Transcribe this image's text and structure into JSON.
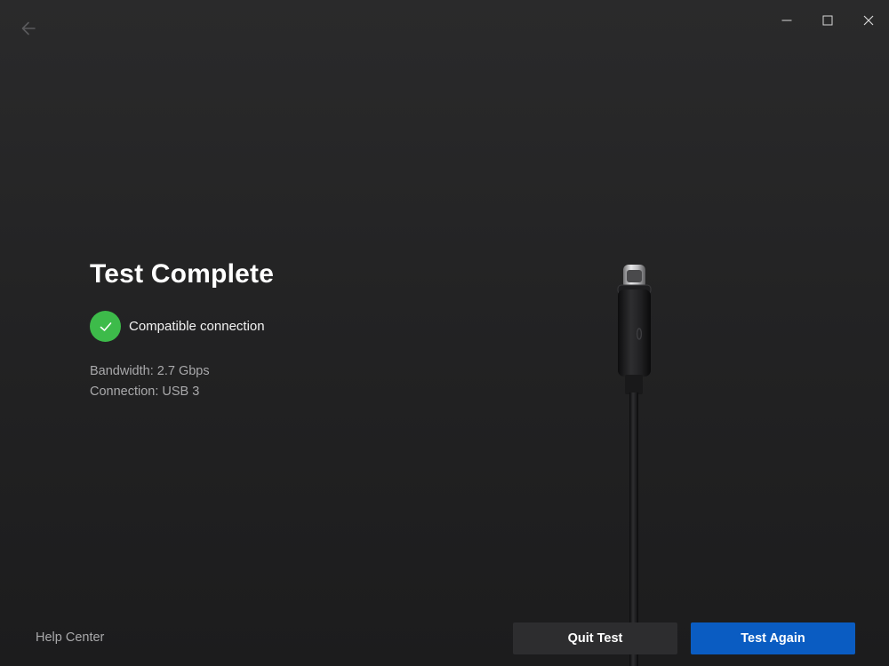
{
  "window": {
    "controls": {
      "minimize_icon": "minimize-icon",
      "maximize_icon": "maximize-icon",
      "close_icon": "close-icon"
    },
    "back_icon": "arrow-left-icon"
  },
  "main": {
    "title": "Test Complete",
    "status": {
      "icon": "check-icon",
      "text": "Compatible connection",
      "color": "#3dbb4a"
    },
    "details": {
      "bandwidth": "Bandwidth: 2.7 Gbps",
      "connection": "Connection: USB 3"
    },
    "illustration": "usb-c-cable"
  },
  "footer": {
    "help_label": "Help Center",
    "quit_label": "Quit Test",
    "again_label": "Test Again",
    "accent_color": "#0a5cc2"
  }
}
